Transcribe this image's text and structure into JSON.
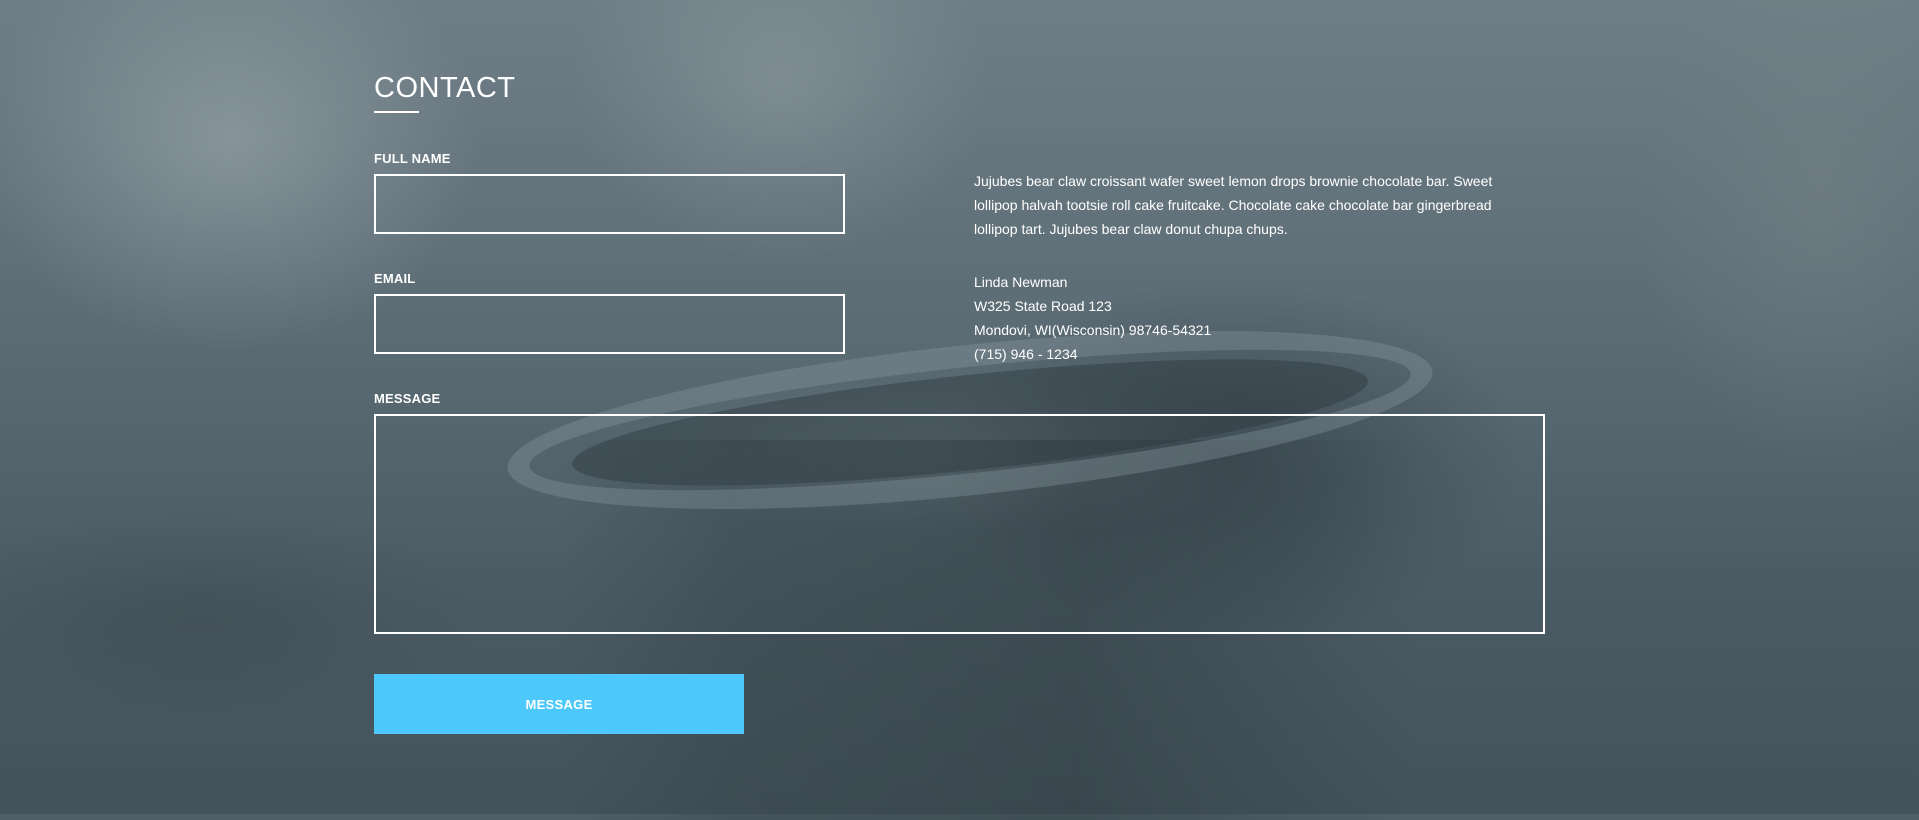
{
  "contact": {
    "title": "CONTACT",
    "fields": {
      "full_name_label": "FULL NAME",
      "full_name_value": "",
      "email_label": "EMAIL",
      "email_value": "",
      "message_label": "MESSAGE",
      "message_value": ""
    },
    "submit_label": "MESSAGE"
  },
  "info": {
    "description": "Jujubes bear claw croissant wafer sweet lemon drops brownie chocolate bar. Sweet lollipop halvah tootsie roll cake fruitcake. Chocolate cake chocolate bar gingerbread lollipop tart. Jujubes bear claw donut chupa chups.",
    "name": "Linda Newman",
    "street": "W325 State Road 123",
    "city": "Mondovi, WI(Wisconsin) 98746-54321",
    "phone": "(715) 946 - 1234"
  },
  "colors": {
    "accent": "#4dc8fa",
    "text": "#ffffff"
  }
}
